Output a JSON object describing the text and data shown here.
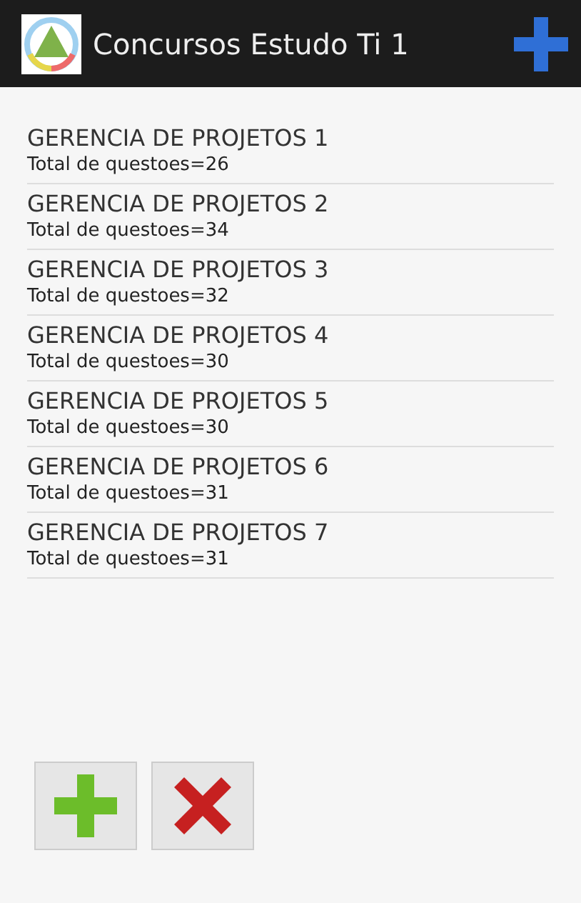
{
  "action_bar": {
    "title": "Concursos Estudo Ti 1"
  },
  "items": [
    {
      "title": "GERENCIA DE PROJETOS 1",
      "subtitle": "Total de questoes=26"
    },
    {
      "title": "GERENCIA DE PROJETOS 2",
      "subtitle": "Total de questoes=34"
    },
    {
      "title": "GERENCIA DE PROJETOS 3",
      "subtitle": "Total de questoes=32"
    },
    {
      "title": "GERENCIA DE PROJETOS 4",
      "subtitle": "Total de questoes=30"
    },
    {
      "title": "GERENCIA DE PROJETOS 5",
      "subtitle": "Total de questoes=30"
    },
    {
      "title": "GERENCIA DE PROJETOS 6",
      "subtitle": "Total de questoes=31"
    },
    {
      "title": "GERENCIA DE PROJETOS 7",
      "subtitle": "Total de questoes=31"
    }
  ]
}
